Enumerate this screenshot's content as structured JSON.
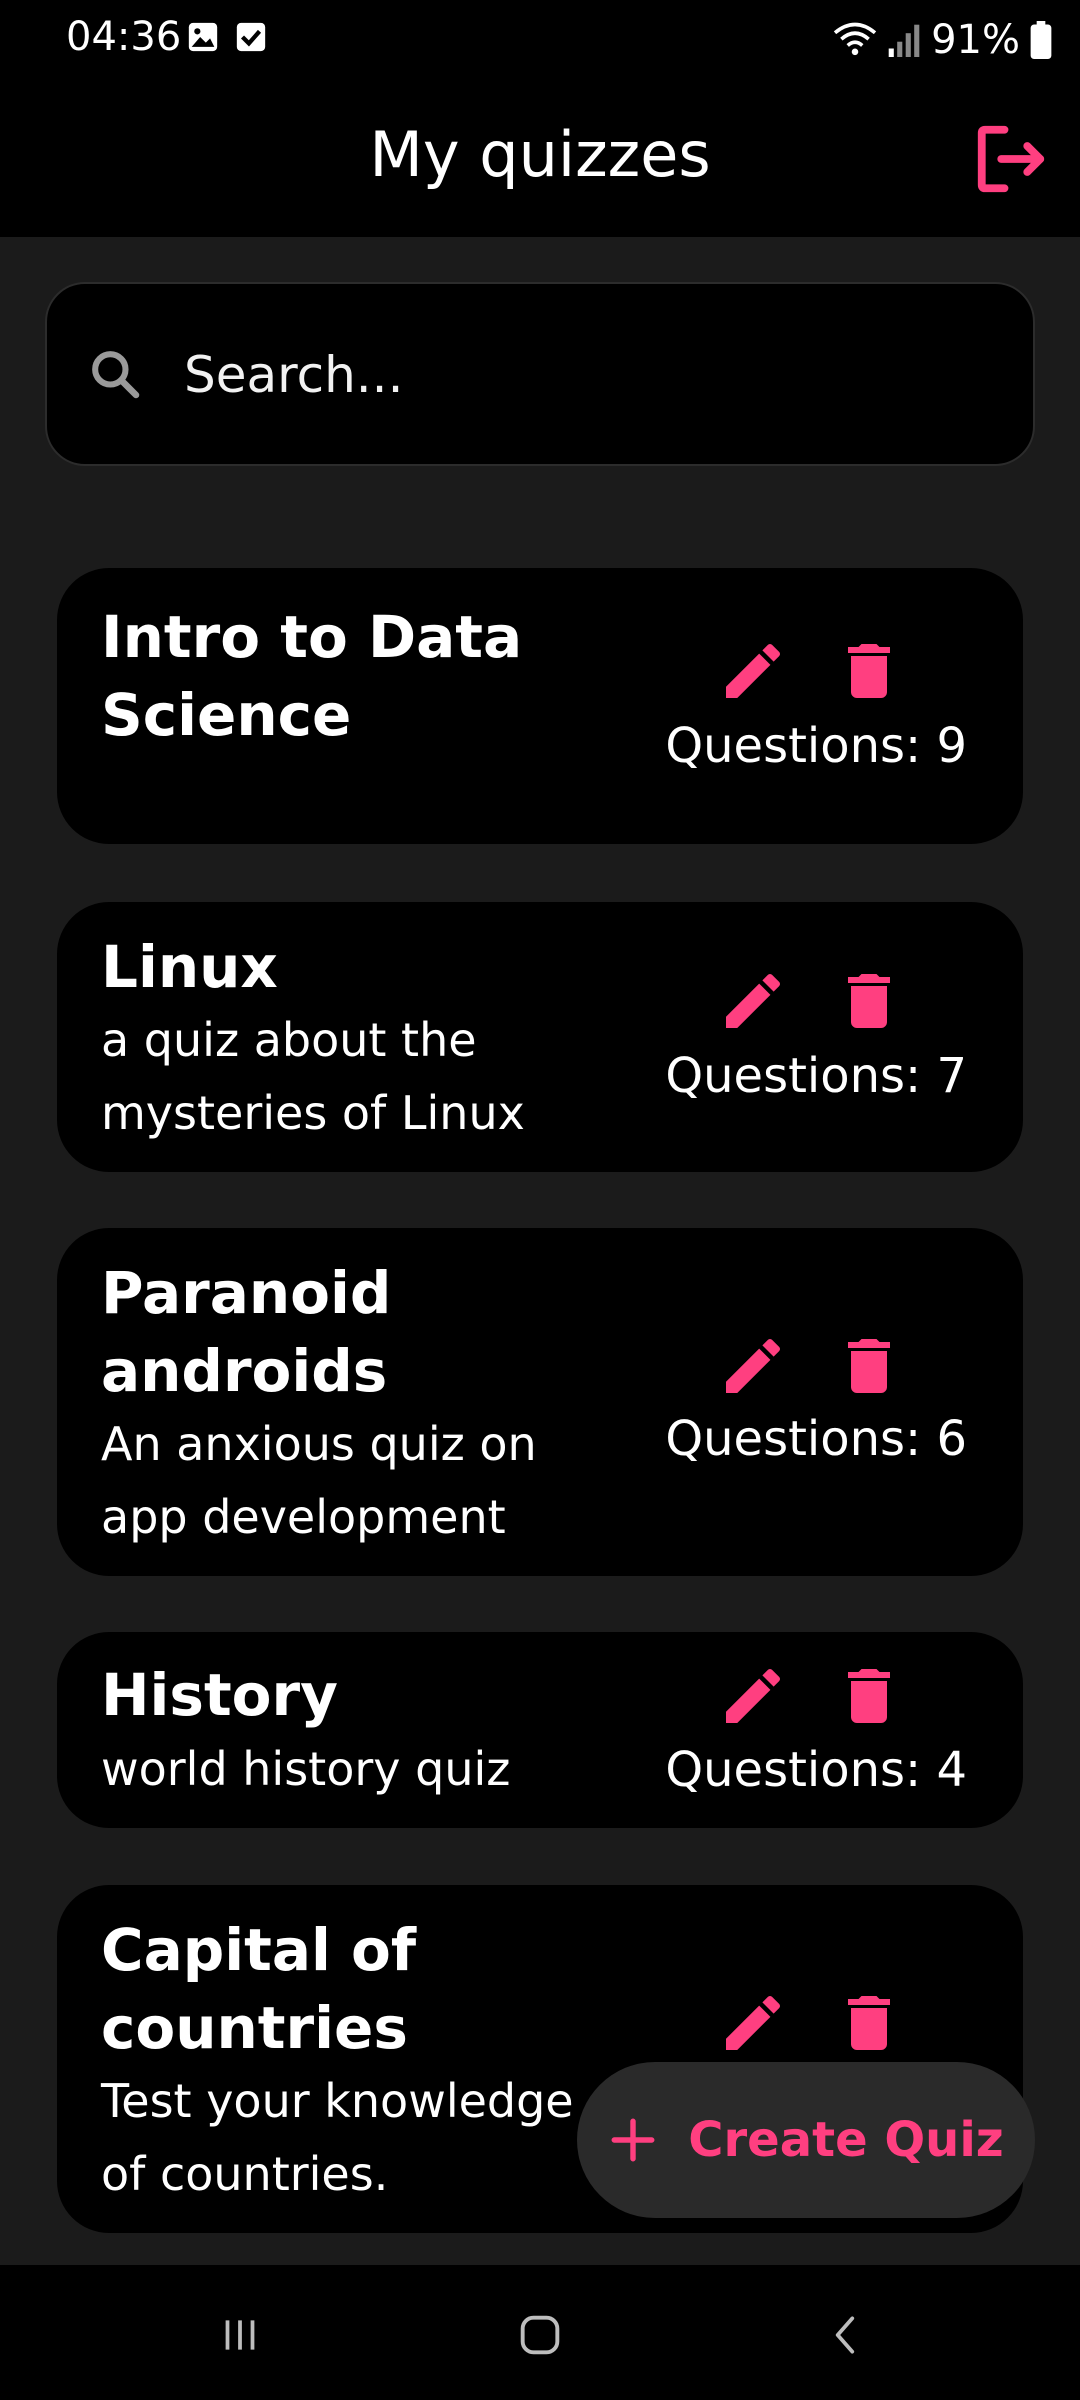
{
  "status_bar": {
    "time": "04:36",
    "battery": "91%",
    "icons": [
      "image-icon",
      "checkbox-icon",
      "wifi-icon",
      "signal-icon",
      "battery-icon"
    ]
  },
  "app_bar": {
    "title": "My quizzes",
    "logout_icon": "logout-icon"
  },
  "search": {
    "placeholder": "Search...",
    "value": "",
    "icon": "search-icon"
  },
  "quizzes": [
    {
      "title_lines": [
        "Intro to Data",
        "Science"
      ],
      "description_lines": [],
      "questions": "Questions: 9"
    },
    {
      "title_lines": [
        "Linux"
      ],
      "description_lines": [
        "a quiz about the",
        "mysteries of Linux"
      ],
      "questions": "Questions: 7"
    },
    {
      "title_lines": [
        "Paranoid",
        "androids"
      ],
      "description_lines": [
        "An anxious quiz on",
        "app development"
      ],
      "questions": "Questions: 6"
    },
    {
      "title_lines": [
        "History"
      ],
      "description_lines": [
        "world history quiz"
      ],
      "questions": "Questions: 4"
    },
    {
      "title_lines": [
        "Capital of",
        "countries"
      ],
      "description_lines": [
        "Test your knowledge",
        "of countries."
      ],
      "questions": ""
    }
  ],
  "fab": {
    "label": "Create Quiz",
    "icon": "plus-icon"
  },
  "colors": {
    "accent": "#ff3f80",
    "background": "#1b1b1b",
    "card": "#000000"
  },
  "nav_bar": {
    "icons": [
      "recents-icon",
      "home-icon",
      "back-icon"
    ]
  }
}
